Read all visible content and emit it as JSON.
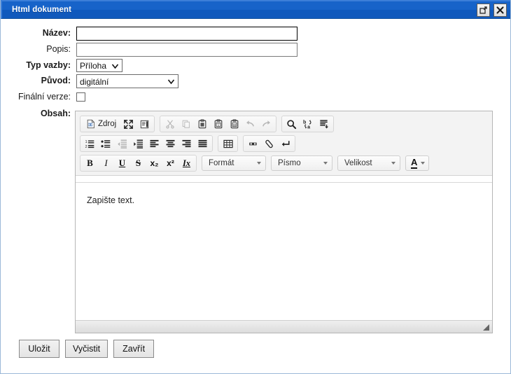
{
  "window": {
    "title": "Html dokument",
    "maximize_icon": "maximize-icon",
    "close_icon": "close-icon"
  },
  "form": {
    "nazev": {
      "label": "Název:",
      "value": "",
      "placeholder": ""
    },
    "popis": {
      "label": "Popis:",
      "value": "",
      "placeholder": ""
    },
    "typ_vazby": {
      "label": "Typ vazby:",
      "selected": "Příloha"
    },
    "puvod": {
      "label": "Původ:",
      "selected": "digitální"
    },
    "finalni_verze": {
      "label": "Finální verze:",
      "checked": false
    },
    "obsah": {
      "label": "Obsah:"
    }
  },
  "editor": {
    "toolbar_rows": [
      {
        "groups": [
          {
            "buttons": [
              {
                "name": "source-button",
                "label": "Zdroj",
                "icon": "source-icon",
                "disabled": false
              },
              {
                "name": "maximize-button",
                "label": "",
                "icon": "maximize-editor-icon",
                "disabled": false
              },
              {
                "name": "show-blocks-button",
                "label": "",
                "icon": "show-blocks-icon",
                "disabled": false
              }
            ]
          },
          {
            "buttons": [
              {
                "name": "cut-button",
                "label": "",
                "icon": "scissors-icon",
                "disabled": true
              },
              {
                "name": "copy-button",
                "label": "",
                "icon": "copy-icon",
                "disabled": true
              },
              {
                "name": "paste-button",
                "label": "",
                "icon": "clipboard-icon",
                "disabled": false
              },
              {
                "name": "paste-text-button",
                "label": "",
                "icon": "clipboard-text-icon",
                "disabled": false
              },
              {
                "name": "paste-word-button",
                "label": "",
                "icon": "clipboard-word-icon",
                "disabled": false
              },
              {
                "name": "undo-button",
                "label": "",
                "icon": "undo-arrow-icon",
                "disabled": true
              },
              {
                "name": "redo-button",
                "label": "",
                "icon": "redo-arrow-icon",
                "disabled": true
              }
            ]
          },
          {
            "buttons": [
              {
                "name": "find-button",
                "label": "",
                "icon": "magnifier-icon",
                "disabled": false
              },
              {
                "name": "replace-button",
                "label": "",
                "icon": "replace-icon",
                "disabled": false
              },
              {
                "name": "select-all-button",
                "label": "",
                "icon": "select-all-icon",
                "disabled": false
              }
            ]
          }
        ]
      },
      {
        "groups": [
          {
            "buttons": [
              {
                "name": "numbered-list-button",
                "label": "",
                "icon": "numbered-list-icon",
                "disabled": false
              },
              {
                "name": "bulleted-list-button",
                "label": "",
                "icon": "bulleted-list-icon",
                "disabled": false
              },
              {
                "name": "outdent-button",
                "label": "",
                "icon": "outdent-icon",
                "disabled": true
              },
              {
                "name": "indent-button",
                "label": "",
                "icon": "indent-icon",
                "disabled": false
              },
              {
                "name": "align-left-button",
                "label": "",
                "icon": "align-left-icon",
                "disabled": false
              },
              {
                "name": "align-center-button",
                "label": "",
                "icon": "align-center-icon",
                "disabled": false
              },
              {
                "name": "align-right-button",
                "label": "",
                "icon": "align-right-icon",
                "disabled": false
              },
              {
                "name": "align-justify-button",
                "label": "",
                "icon": "align-justify-icon",
                "disabled": false
              }
            ]
          },
          {
            "buttons": [
              {
                "name": "table-button",
                "label": "",
                "icon": "table-icon",
                "disabled": false
              }
            ]
          },
          {
            "buttons": [
              {
                "name": "anchor-button",
                "label": "",
                "icon": "anchor-flag-icon",
                "disabled": false
              },
              {
                "name": "remove-format-button",
                "label": "",
                "icon": "eraser-icon",
                "disabled": false
              },
              {
                "name": "line-break-button",
                "label": "",
                "icon": "return-arrow-icon",
                "disabled": false
              }
            ]
          }
        ]
      },
      {
        "groups": [
          {
            "buttons": [
              {
                "name": "bold-button",
                "label": "B",
                "icon": "bold-icon",
                "disabled": false
              },
              {
                "name": "italic-button",
                "label": "I",
                "icon": "italic-icon",
                "disabled": false
              },
              {
                "name": "underline-button",
                "label": "U",
                "icon": "underline-icon",
                "disabled": false
              },
              {
                "name": "strike-button",
                "label": "S",
                "icon": "strikethrough-icon",
                "disabled": false
              },
              {
                "name": "subscript-button",
                "label": "x₂",
                "icon": "subscript-icon",
                "disabled": false
              },
              {
                "name": "superscript-button",
                "label": "x²",
                "icon": "superscript-icon",
                "disabled": false
              },
              {
                "name": "remove-styles-button",
                "label": "Ix",
                "icon": "remove-styles-icon",
                "disabled": false
              }
            ]
          }
        ],
        "combos": [
          {
            "name": "format-combo",
            "label": "Formát"
          },
          {
            "name": "font-combo",
            "label": "Písmo"
          },
          {
            "name": "size-combo",
            "label": "Velikost"
          }
        ],
        "color_button": {
          "name": "text-color-button",
          "glyph": "A",
          "icon": "text-color-icon"
        }
      }
    ],
    "content_text": "Zapište text.",
    "resize_grip_icon": "resize-grip-icon"
  },
  "footer": {
    "save_label": "Uložit",
    "clear_label": "Vyčistit",
    "close_label": "Zavřít"
  },
  "colors": {
    "titlebar_blue": "#1763c9",
    "titlebar_border": "#3c7fd8",
    "toolbar_bg": "#f3f3f3",
    "editor_border": "#b6b6b6"
  }
}
